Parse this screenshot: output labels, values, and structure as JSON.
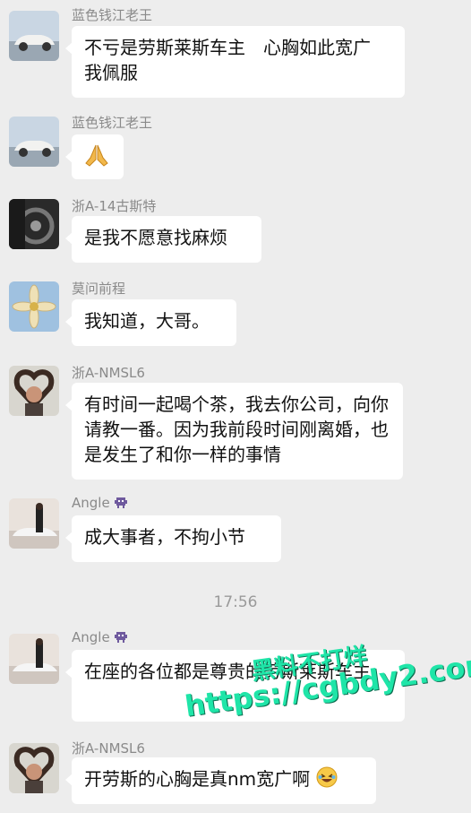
{
  "messages": [
    {
      "name": "蓝色钱江老王",
      "text": "不亏是劳斯莱斯车主　心胸如此宽广 我佩服"
    },
    {
      "name": "蓝色钱江老王",
      "text": "",
      "emoji": "praying-hands-emoji"
    },
    {
      "name": "浙A-14古斯特",
      "text": "是我不愿意找麻烦"
    },
    {
      "name": "莫问前程",
      "text": "我知道，大哥。"
    },
    {
      "name": "浙A-NMSL6",
      "text": "有时间一起喝个茶，我去你公司，向你请教一番。因为我前段时间刚离婚，也是发生了和你一样的事情"
    },
    {
      "name": "Angle",
      "text": "成大事者，不拘小节",
      "name_icon": "alien-icon"
    },
    {
      "name": "Angle",
      "text": "在座的各位都是尊贵的劳斯莱斯车主",
      "name_icon": "alien-icon"
    },
    {
      "name": "浙A-NMSL6",
      "text": "开劳斯的心胸是真nm宽广啊",
      "trailing_emoji": "laughing-face-emoji"
    }
  ],
  "timestamp": "17:56",
  "watermark": {
    "line1": "黑料不打烊",
    "line2": "https://cgbdy2.com"
  },
  "colors": {
    "background": "#ededed",
    "bubble": "#ffffff",
    "name": "#8a8a8a",
    "watermark": "#1fe5a8"
  }
}
